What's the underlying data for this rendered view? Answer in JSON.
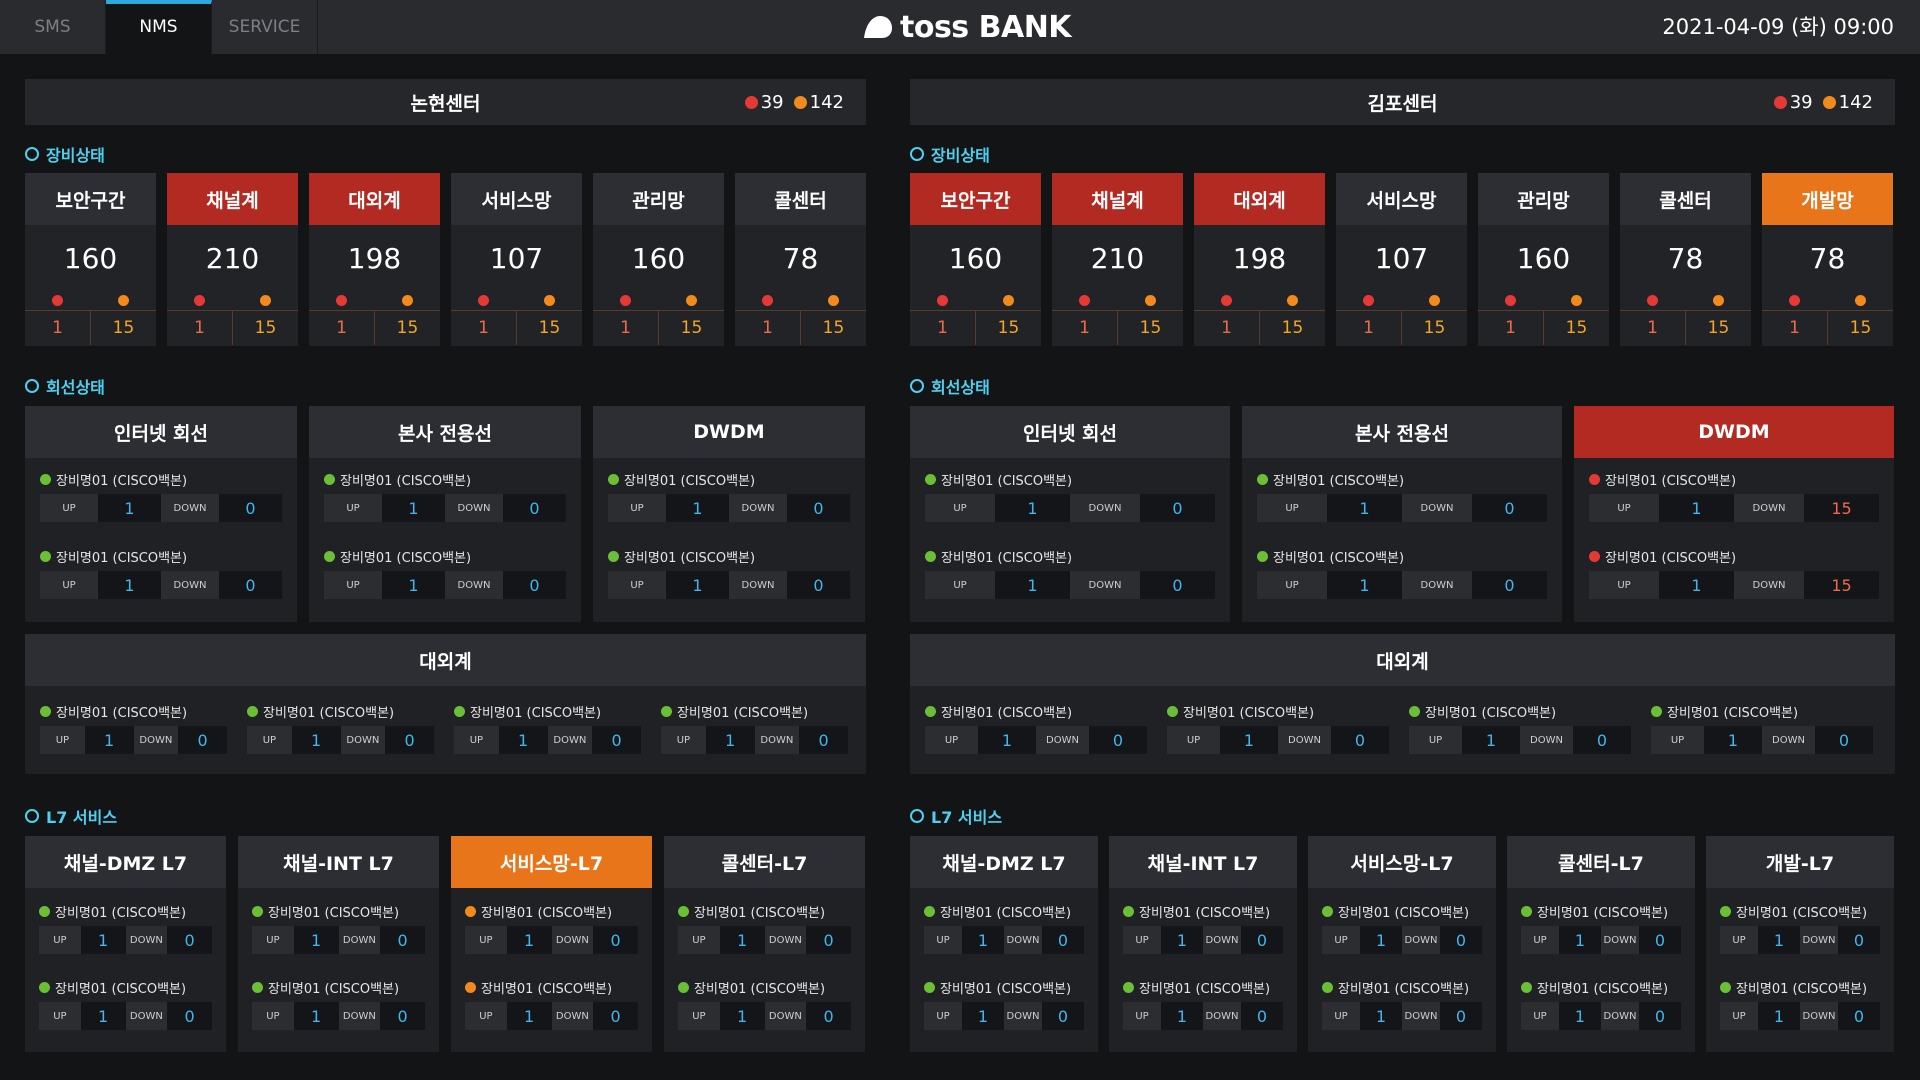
{
  "tabs": [
    "SMS",
    "NMS",
    "SERVICE"
  ],
  "logo_text": "toss BANK",
  "datetime": "2021-04-09 (화) 09:00",
  "centers": [
    {
      "name": "논현센터",
      "alarm_red": "39",
      "alarm_orange": "142",
      "sections": {
        "equip": "장비상태",
        "line": "회선상태",
        "l7": "L7 서비스"
      },
      "equipment": [
        {
          "label": "보안구간",
          "count": "160",
          "red": "1",
          "orange": "15",
          "status": "normal"
        },
        {
          "label": "채널계",
          "count": "210",
          "red": "1",
          "orange": "15",
          "status": "red"
        },
        {
          "label": "대외계",
          "count": "198",
          "red": "1",
          "orange": "15",
          "status": "red"
        },
        {
          "label": "서비스망",
          "count": "107",
          "red": "1",
          "orange": "15",
          "status": "normal"
        },
        {
          "label": "관리망",
          "count": "160",
          "red": "1",
          "orange": "15",
          "status": "normal"
        },
        {
          "label": "콜센터",
          "count": "78",
          "red": "1",
          "orange": "15",
          "status": "normal"
        }
      ],
      "lines": [
        {
          "title": "인터넷 회선",
          "status": "normal",
          "devices": [
            {
              "name": "장비명01 (CISCO백본)",
              "up": "1",
              "down": "0",
              "status": "green"
            },
            {
              "name": "장비명01 (CISCO백본)",
              "up": "1",
              "down": "0",
              "status": "green"
            }
          ]
        },
        {
          "title": "본사 전용선",
          "status": "normal",
          "devices": [
            {
              "name": "장비명01 (CISCO백본)",
              "up": "1",
              "down": "0",
              "status": "green"
            },
            {
              "name": "장비명01 (CISCO백본)",
              "up": "1",
              "down": "0",
              "status": "green"
            }
          ]
        },
        {
          "title": "DWDM",
          "status": "normal",
          "devices": [
            {
              "name": "장비명01 (CISCO백본)",
              "up": "1",
              "down": "0",
              "status": "green"
            },
            {
              "name": "장비명01 (CISCO백본)",
              "up": "1",
              "down": "0",
              "status": "green"
            }
          ]
        }
      ],
      "external": {
        "title": "대외계",
        "devices": [
          {
            "name": "장비명01 (CISCO백본)",
            "up": "1",
            "down": "0",
            "status": "green"
          },
          {
            "name": "장비명01 (CISCO백본)",
            "up": "1",
            "down": "0",
            "status": "green"
          },
          {
            "name": "장비명01 (CISCO백본)",
            "up": "1",
            "down": "0",
            "status": "green"
          },
          {
            "name": "장비명01 (CISCO백본)",
            "up": "1",
            "down": "0",
            "status": "green"
          }
        ]
      },
      "l7": [
        {
          "title": "채널-DMZ L7",
          "status": "normal",
          "devices": [
            {
              "name": "장비명01 (CISCO백본)",
              "up": "1",
              "down": "0",
              "status": "green"
            },
            {
              "name": "장비명01 (CISCO백본)",
              "up": "1",
              "down": "0",
              "status": "green"
            }
          ]
        },
        {
          "title": "채널-INT L7",
          "status": "normal",
          "devices": [
            {
              "name": "장비명01 (CISCO백본)",
              "up": "1",
              "down": "0",
              "status": "green"
            },
            {
              "name": "장비명01 (CISCO백본)",
              "up": "1",
              "down": "0",
              "status": "green"
            }
          ]
        },
        {
          "title": "서비스망-L7",
          "status": "orange",
          "devices": [
            {
              "name": "장비명01 (CISCO백본)",
              "up": "1",
              "down": "0",
              "status": "orange"
            },
            {
              "name": "장비명01 (CISCO백본)",
              "up": "1",
              "down": "0",
              "status": "orange"
            }
          ]
        },
        {
          "title": "콜센터-L7",
          "status": "normal",
          "devices": [
            {
              "name": "장비명01 (CISCO백본)",
              "up": "1",
              "down": "0",
              "status": "green"
            },
            {
              "name": "장비명01 (CISCO백본)",
              "up": "1",
              "down": "0",
              "status": "green"
            }
          ]
        }
      ]
    },
    {
      "name": "김포센터",
      "alarm_red": "39",
      "alarm_orange": "142",
      "sections": {
        "equip": "장비상태",
        "line": "회선상태",
        "l7": "L7 서비스"
      },
      "equipment": [
        {
          "label": "보안구간",
          "count": "160",
          "red": "1",
          "orange": "15",
          "status": "red"
        },
        {
          "label": "채널계",
          "count": "210",
          "red": "1",
          "orange": "15",
          "status": "red"
        },
        {
          "label": "대외계",
          "count": "198",
          "red": "1",
          "orange": "15",
          "status": "red"
        },
        {
          "label": "서비스망",
          "count": "107",
          "red": "1",
          "orange": "15",
          "status": "normal"
        },
        {
          "label": "관리망",
          "count": "160",
          "red": "1",
          "orange": "15",
          "status": "normal"
        },
        {
          "label": "콜센터",
          "count": "78",
          "red": "1",
          "orange": "15",
          "status": "normal"
        },
        {
          "label": "개발망",
          "count": "78",
          "red": "1",
          "orange": "15",
          "status": "orange"
        }
      ],
      "lines": [
        {
          "title": "인터넷 회선",
          "status": "normal",
          "devices": [
            {
              "name": "장비명01 (CISCO백본)",
              "up": "1",
              "down": "0",
              "status": "green"
            },
            {
              "name": "장비명01 (CISCO백본)",
              "up": "1",
              "down": "0",
              "status": "green"
            }
          ]
        },
        {
          "title": "본사 전용선",
          "status": "normal",
          "devices": [
            {
              "name": "장비명01 (CISCO백본)",
              "up": "1",
              "down": "0",
              "status": "green"
            },
            {
              "name": "장비명01 (CISCO백본)",
              "up": "1",
              "down": "0",
              "status": "green"
            }
          ]
        },
        {
          "title": "DWDM",
          "status": "red",
          "devices": [
            {
              "name": "장비명01 (CISCO백본)",
              "up": "1",
              "down": "15",
              "status": "red"
            },
            {
              "name": "장비명01 (CISCO백본)",
              "up": "1",
              "down": "15",
              "status": "red"
            }
          ]
        }
      ],
      "external": {
        "title": "대외계",
        "devices": [
          {
            "name": "장비명01 (CISCO백본)",
            "up": "1",
            "down": "0",
            "status": "green"
          },
          {
            "name": "장비명01 (CISCO백본)",
            "up": "1",
            "down": "0",
            "status": "green"
          },
          {
            "name": "장비명01 (CISCO백본)",
            "up": "1",
            "down": "0",
            "status": "green"
          },
          {
            "name": "장비명01 (CISCO백본)",
            "up": "1",
            "down": "0",
            "status": "green"
          }
        ]
      },
      "l7": [
        {
          "title": "채널-DMZ L7",
          "status": "normal",
          "devices": [
            {
              "name": "장비명01 (CISCO백본)",
              "up": "1",
              "down": "0",
              "status": "green"
            },
            {
              "name": "장비명01 (CISCO백본)",
              "up": "1",
              "down": "0",
              "status": "green"
            }
          ]
        },
        {
          "title": "채널-INT L7",
          "status": "normal",
          "devices": [
            {
              "name": "장비명01 (CISCO백본)",
              "up": "1",
              "down": "0",
              "status": "green"
            },
            {
              "name": "장비명01 (CISCO백본)",
              "up": "1",
              "down": "0",
              "status": "green"
            }
          ]
        },
        {
          "title": "서비스망-L7",
          "status": "normal",
          "devices": [
            {
              "name": "장비명01 (CISCO백본)",
              "up": "1",
              "down": "0",
              "status": "green"
            },
            {
              "name": "장비명01 (CISCO백본)",
              "up": "1",
              "down": "0",
              "status": "green"
            }
          ]
        },
        {
          "title": "콜센터-L7",
          "status": "normal",
          "devices": [
            {
              "name": "장비명01 (CISCO백본)",
              "up": "1",
              "down": "0",
              "status": "green"
            },
            {
              "name": "장비명01 (CISCO백본)",
              "up": "1",
              "down": "0",
              "status": "green"
            }
          ]
        },
        {
          "title": "개발-L7",
          "status": "normal",
          "devices": [
            {
              "name": "장비명01 (CISCO백본)",
              "up": "1",
              "down": "0",
              "status": "green"
            },
            {
              "name": "장비명01 (CISCO백본)",
              "up": "1",
              "down": "0",
              "status": "green"
            }
          ]
        }
      ]
    }
  ],
  "labels": {
    "up": "UP",
    "down": "DOWN"
  },
  "colors": {
    "accent": "#4fd0f0",
    "alarm_red": "#b22a22",
    "alarm_orange": "#e8751a",
    "ok_green": "#6abf36",
    "value_blue": "#3fb6f0"
  }
}
